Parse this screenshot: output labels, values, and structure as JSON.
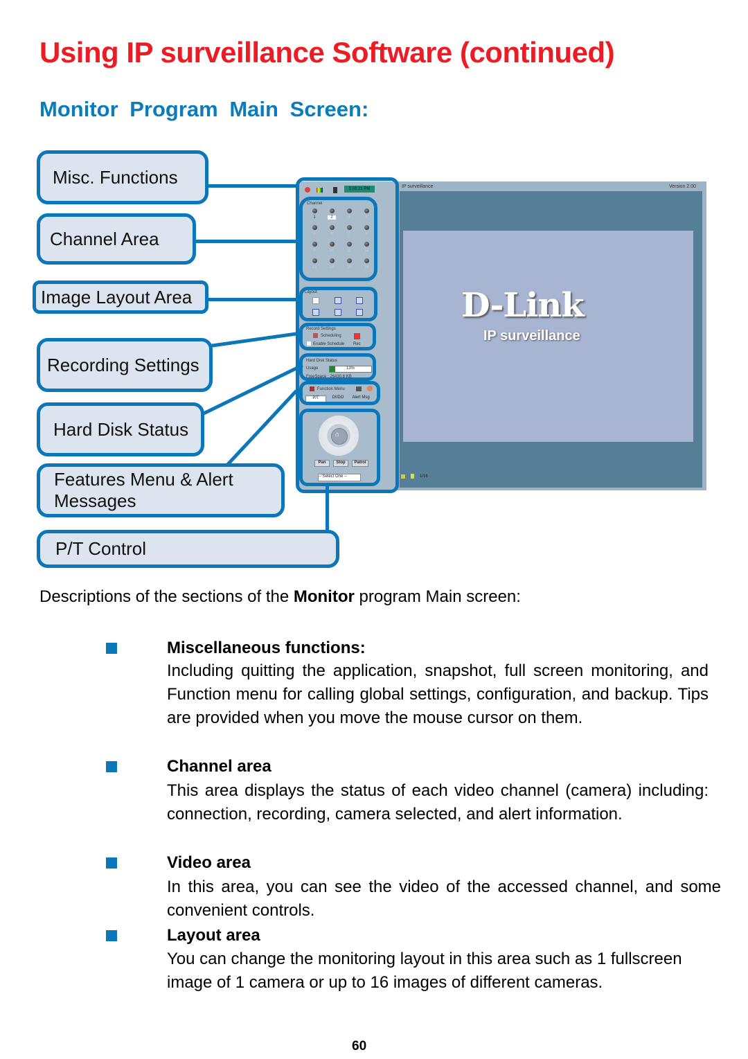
{
  "page": {
    "title": "Using IP surveillance Software (continued)",
    "subtitle": "Monitor Program Main Screen:",
    "page_number": "60"
  },
  "callouts": {
    "misc": "Misc. Functions",
    "channel": "Channel Area",
    "layout": "Image Layout Area",
    "recording": "Recording Settings",
    "harddisk": "Hard Disk Status",
    "features_line1": "Features Menu & Alert",
    "features_line2": "Messages",
    "pt": "P/T Control"
  },
  "app": {
    "title": "IP surveillance",
    "version": "Version 2.00",
    "clock": "5:03:21 PM",
    "channel_label": "Channel",
    "channels": [
      "1",
      "2",
      "3",
      "4",
      "5",
      "6",
      "7",
      "8",
      "9",
      "10",
      "11",
      "12",
      "13",
      "14",
      "15",
      "16"
    ],
    "selected_channel": "2",
    "layout_label": "Layout",
    "record_label": "Record Settings",
    "scheduling": "Scheduling",
    "enable_schedule": "Enable Schedule",
    "rec": "Rec",
    "hdd_label": "Hard Disk Status",
    "usage_label": "Usage",
    "usage_percent": 13,
    "usage_text": "13%",
    "free_space": "FreeSpace : 26430.8 KB",
    "function_menu": "Function Menu",
    "tabs": [
      "P/T",
      "DI/DO",
      "Alert Msg"
    ],
    "pt_buttons": [
      "Pan",
      "Stop",
      "Patrol"
    ],
    "preset_select": "-- Select One --",
    "status_page": "1/16",
    "logo": "D-Link",
    "logo_sub": "IP surveillance",
    "colors": {
      "highlight": "#0b76b8",
      "title_red": "#ec1c24",
      "usage_green": "#1a8a2a"
    }
  },
  "body": {
    "intro_pre": "Descriptions of the sections of the ",
    "intro_bold": "Monitor",
    "intro_post": " program Main screen:",
    "items": [
      {
        "heading": "Miscellaneous functions:",
        "text": "Including quitting the application, snapshot, full screen monitoring, and Function menu for calling global settings, configuration, and backup. Tips are provided when you move the mouse cursor on them."
      },
      {
        "heading": "Channel area",
        "text": "This area displays the status of each video channel (camera) including: connection, recording, camera selected, and alert information."
      },
      {
        "heading": "Video area",
        "text": "In this area, you can see the video of the accessed channel, and some convenient controls."
      },
      {
        "heading": "Layout area",
        "text": "You can change the monitoring layout in this area such as 1 fullscreen image of 1 camera or up to 16 images of different cameras."
      }
    ]
  }
}
